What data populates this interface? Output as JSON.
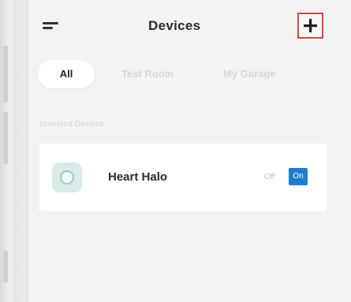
{
  "header": {
    "title": "Devices",
    "menu_icon": "hamburger-menu-icon",
    "add_icon": "plus-icon"
  },
  "tabs": [
    {
      "label": "All",
      "selected": true
    },
    {
      "label": "Test Room",
      "selected": false
    },
    {
      "label": "My Garage",
      "selected": false
    }
  ],
  "section": {
    "label": "Untested Devices"
  },
  "devices": [
    {
      "name": "Heart Halo",
      "off_label": "Off",
      "on_label": "On",
      "state": "on"
    }
  ],
  "colors": {
    "accent": "#1f7fce",
    "highlight_border": "#d64545",
    "device_icon_bg": "#d8ebe8"
  }
}
